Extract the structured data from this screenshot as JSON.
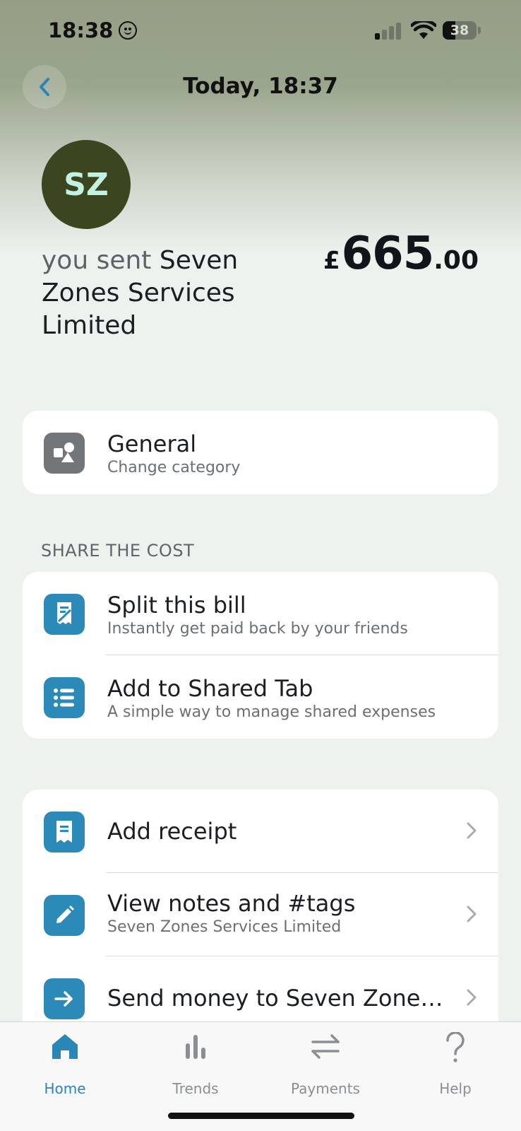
{
  "status_bar": {
    "time": "18:38",
    "battery": "38"
  },
  "header": {
    "title": "Today, 18:37"
  },
  "merchant": {
    "initials": "SZ",
    "sent_prefix": "you sent",
    "name": "Seven Zones Services Limited",
    "amount_currency": "£",
    "amount_whole": "665",
    "amount_decimal": ".00"
  },
  "category": {
    "title": "General",
    "subtitle": "Change category"
  },
  "share": {
    "section_label": "SHARE THE COST",
    "items": [
      {
        "title": "Split this bill",
        "subtitle": "Instantly get paid back by your friends"
      },
      {
        "title": "Add to Shared Tab",
        "subtitle": "A simple way to manage shared expenses"
      }
    ]
  },
  "actions": {
    "items": [
      {
        "title": "Add receipt"
      },
      {
        "title": "View notes and #tags",
        "subtitle": "Seven Zones Services Limited"
      },
      {
        "title": "Send money to Seven Zone…"
      }
    ]
  },
  "tab_bar": {
    "items": [
      {
        "label": "Home",
        "icon": "home-icon"
      },
      {
        "label": "Trends",
        "icon": "trends-icon"
      },
      {
        "label": "Payments",
        "icon": "payments-icon"
      },
      {
        "label": "Help",
        "icon": "help-icon"
      }
    ]
  },
  "colors": {
    "accent": "#2a86b6",
    "icon_blue": "#2b8ab8",
    "avatar_bg": "#3b4520",
    "avatar_text": "#c3f2e2"
  }
}
